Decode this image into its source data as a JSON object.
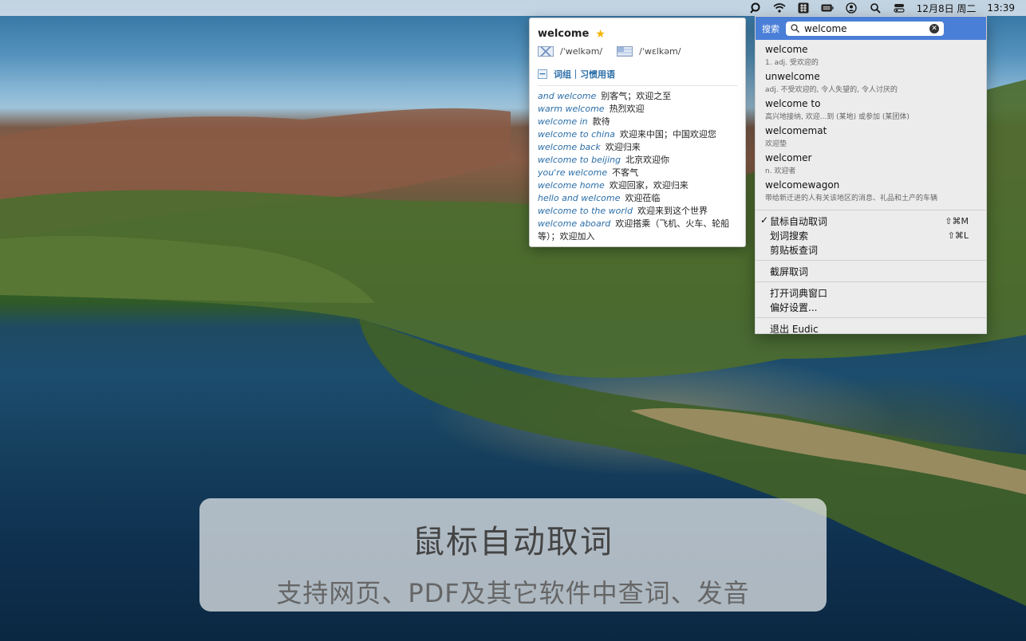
{
  "menubar": {
    "icons": [
      "eudic-icon",
      "wifi-icon",
      "input-method-icon",
      "battery-icon",
      "user-icon",
      "search-icon",
      "control-center-icon"
    ],
    "date": "12月8日 周二",
    "time": "13:39"
  },
  "definition": {
    "word": "welcome",
    "uk_phonetic": "/ˈwelkəm/",
    "us_phonetic": "/ˈwɛlkəm/",
    "section_title": "词组｜习惯用语",
    "phrases": [
      {
        "en": "and welcome",
        "zh": "别客气；欢迎之至"
      },
      {
        "en": "warm welcome",
        "zh": "热烈欢迎"
      },
      {
        "en": "welcome in",
        "zh": "款待"
      },
      {
        "en": "welcome to china",
        "zh": "欢迎来中国；中国欢迎您"
      },
      {
        "en": "welcome back",
        "zh": "欢迎归来"
      },
      {
        "en": "welcome to beijing",
        "zh": "北京欢迎你"
      },
      {
        "en": "you're welcome",
        "zh": "不客气"
      },
      {
        "en": "welcome home",
        "zh": "欢迎回家，欢迎归来"
      },
      {
        "en": "hello and welcome",
        "zh": "欢迎莅临"
      },
      {
        "en": "welcome to the world",
        "zh": "欢迎来到这个世界"
      },
      {
        "en": "welcome aboard",
        "zh": "欢迎搭乘（飞机、火车、轮船等）；欢迎加入"
      }
    ]
  },
  "menu": {
    "search_label": "搜索",
    "search_value": "welcome",
    "suggestions": [
      {
        "word": "welcome",
        "def": "1. adj. 受欢迎的"
      },
      {
        "word": "unwelcome",
        "def": "adj. 不受欢迎的, 令人失望的, 令人讨厌的"
      },
      {
        "word": "welcome to",
        "def": "高兴地接纳, 欢迎...到 (某地) 或参加 (某团体)"
      },
      {
        "word": "welcomemat",
        "def": "欢迎垫"
      },
      {
        "word": "welcomer",
        "def": "n. 欢迎者"
      },
      {
        "word": "welcomewagon",
        "def": "带给新迁进的人有关该地区的消息、礼品和土产的车辆"
      }
    ],
    "auto_lookup": "鼠标自动取词",
    "auto_lookup_shortcut": "⇧⌘M",
    "select_lookup": "划词搜索",
    "select_lookup_shortcut": "⇧⌘L",
    "clipboard_lookup": "剪贴板查词",
    "screen_lookup": "截屏取词",
    "open_window": "打开词典窗口",
    "preferences": "偏好设置...",
    "quit": "退出 Eudic"
  },
  "caption": {
    "title": "鼠标自动取词",
    "subtitle": "支持网页、PDF及其它软件中查词、发音"
  },
  "colors": {
    "accent": "#4a7fd8",
    "link": "#2b6ea8",
    "star": "#f4b400"
  }
}
